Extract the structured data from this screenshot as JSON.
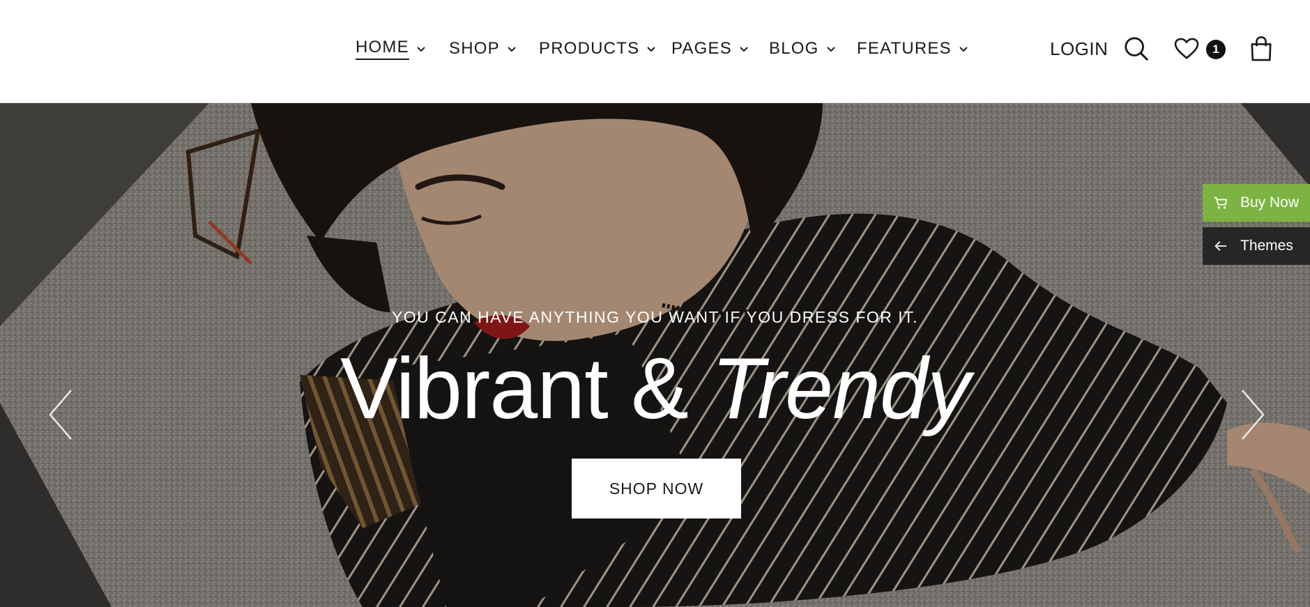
{
  "nav": {
    "items": [
      {
        "label": "HOME",
        "active": true
      },
      {
        "label": "SHOP",
        "active": false
      },
      {
        "label": "PRODUCTS",
        "active": false
      },
      {
        "label": "PAGES",
        "active": false
      },
      {
        "label": "BLOG",
        "active": false
      },
      {
        "label": "FEATURES",
        "active": false
      }
    ]
  },
  "header": {
    "login_label": "LOGIN",
    "wishlist_count": "1",
    "icons": [
      "search-icon",
      "heart-icon",
      "shopping-bag-icon"
    ]
  },
  "hero": {
    "tagline": "YOU CAN HAVE ANYTHING YOU WANT IF YOU DRESS FOR IT.",
    "headline_part1": "Vibrant & ",
    "headline_part2": "Trendy",
    "cta_label": "SHOP NOW"
  },
  "side": {
    "buy_label": "Buy Now",
    "themes_label": "Themes",
    "buy_color": "#7cb342",
    "themes_color": "#262626"
  }
}
